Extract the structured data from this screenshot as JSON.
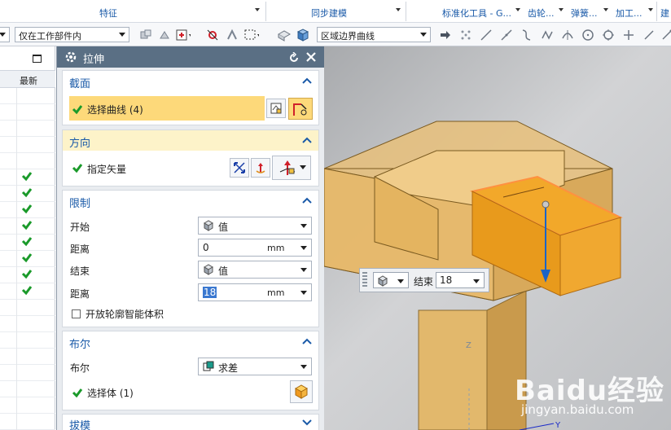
{
  "ribbon": {
    "groups": [
      "特征",
      "同步建模",
      "标准化工具 - G...",
      "齿轮...",
      "弹簧...",
      "加工...",
      "建"
    ]
  },
  "selection_bar": {
    "scope_filter": "仅在工作部件内",
    "curve_rule": "区域边界曲线"
  },
  "navigator": {
    "column_latest": "最新",
    "checked_rows": 8
  },
  "dialog": {
    "title": "拉伸",
    "section_profile": {
      "title": "截面",
      "select_curve": "选择曲线 (4)"
    },
    "section_direction": {
      "title": "方向",
      "specify_vector": "指定矢量"
    },
    "section_limits": {
      "title": "限制",
      "start_label": "开始",
      "start_value": "值",
      "distance1_label": "距离",
      "distance1_value": "0",
      "distance1_unit": "mm",
      "end_label": "结束",
      "end_value": "值",
      "distance2_label": "距离",
      "distance2_value": "18",
      "distance2_unit": "mm",
      "open_profile": "开放轮廓智能体积"
    },
    "section_boolean": {
      "title": "布尔",
      "boolean_label": "布尔",
      "boolean_value": "求差",
      "select_body": "选择体 (1)"
    },
    "section_draft": {
      "title": "拔模"
    }
  },
  "viewport": {
    "float_label": "结束",
    "float_value": "18",
    "axis_z": "Z",
    "axis_y": "Y",
    "watermark": "Baidu经验",
    "watermark_sub": "jingyan.baidu.com"
  },
  "colors": {
    "accent_blue": "#1a5aa8",
    "dialog_title": "#5a6f84",
    "selection_yellow": "#fdd97a",
    "check_green": "#1a9a2a",
    "body_tan": "#e6b86a",
    "tool_orange": "#f0a020"
  }
}
